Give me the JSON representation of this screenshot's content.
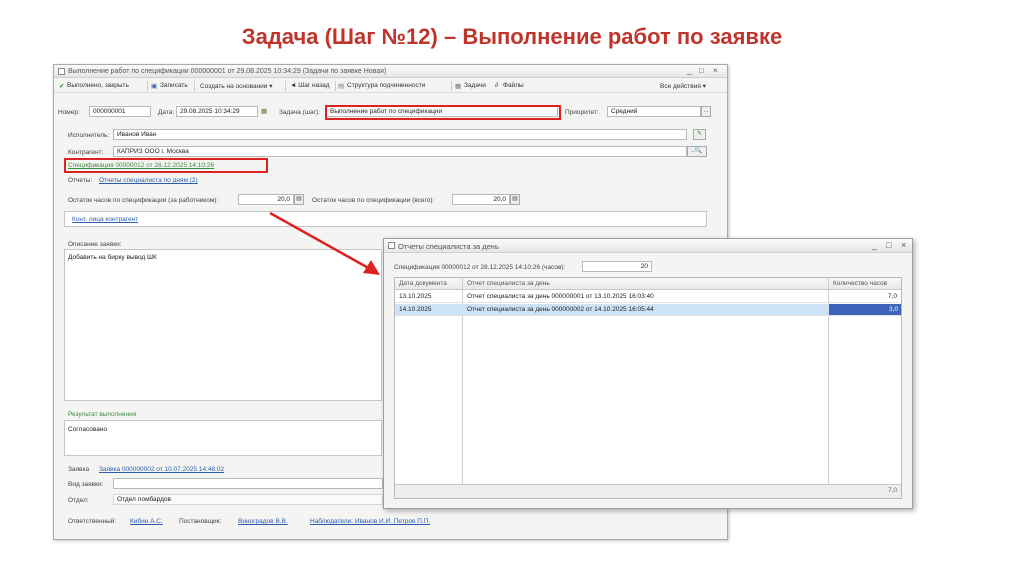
{
  "slide_title": "Задача (Шаг №12) – Выполнение работ по заявке",
  "main_window": {
    "title": "Выполнение работ по спецификации 000000001 от 29.08.2025 10:34:29 (Задачи по заявке Новая)",
    "controls": [
      "_",
      "□",
      "×"
    ],
    "toolbar": {
      "complete_close": "Выполнено, закрыть",
      "save": "Записать",
      "create_based": "Создать на основании ▾",
      "step_back": "◄ Шаг назад",
      "structure": "Структура подчиненности",
      "tasks": "Задачи",
      "files": "Файлы",
      "all_actions": "Все действия ▾"
    },
    "number_label": "Номер:",
    "number_value": "000000001",
    "date_label": "Дата:",
    "date_value": "29.08.2025 10:34:29",
    "task_label": "Задача (шаг):",
    "task_value": "Выполнение работ по спецификации",
    "priority_label": "Приоритет:",
    "priority_value": "Средний",
    "executor_label": "Исполнитель:",
    "executor_value": "Иванов Иван",
    "counterparty_label": "Контрагент:",
    "counterparty_value": "КАПРИЗ ООО г. Москва",
    "spec_link": "Спецификация 00000012 от 28.12.2025 14:10:26",
    "reports_label": "Отчеты:",
    "reports_link": "Отчеты специалиста по дням (2)",
    "remaining_by_worker_label": "Остаток часов по спецификации (за работником):",
    "remaining_by_worker_value": "20,0",
    "remaining_total_label": "Остаток часов по спецификации (всего):",
    "remaining_total_value": "20,0",
    "contacts_link": "Конт. лица контрагент",
    "description_label": "Описание заявки:",
    "description_text": "Добавить на бирку вывод ШК",
    "result_label": "Результат выполнения",
    "result_text": "Согласовано",
    "request_label": "Заявка",
    "request_link": "Заявка 000000002 от 10.07.2025 14:48:02",
    "request_type_label": "Вид заявки:",
    "department_label": "Отдел:",
    "department_value": "Отдел ломбардов",
    "responsible_label": "Ответственный:",
    "responsible_link": "Кибин А.С.",
    "author_label": "Постановщик:",
    "author_link": "Виноградов В.В.",
    "observers_link": "Наблюдатели: Иванов И.И. Петров П.П."
  },
  "popup": {
    "title": "Отчеты специалиста за день",
    "controls": [
      "_",
      "□",
      "×"
    ],
    "spec_label": "Спецификация 00000012 от 28.12.2025 14:10:26 (часов):",
    "spec_hours": "20",
    "columns": [
      "Дата документа",
      "Отчет специалиста за день",
      "Количество часов"
    ],
    "rows": [
      {
        "date": "13.10.2025",
        "report": "Отчет специалиста за день 000000001 от 13.10.2025 16:03:40",
        "hours": "7,0",
        "selected": false
      },
      {
        "date": "14.10.2025",
        "report": "Отчет специалиста за день 000000002 от 14.10.2025 16:05:44",
        "hours": "3,0",
        "selected": true
      }
    ],
    "total": "7,0"
  },
  "colors": {
    "title_red": "#c0352b",
    "highlight_red": "#dd2222",
    "link_blue": "#2a5db0",
    "selection_blue": "#3d64b8"
  }
}
